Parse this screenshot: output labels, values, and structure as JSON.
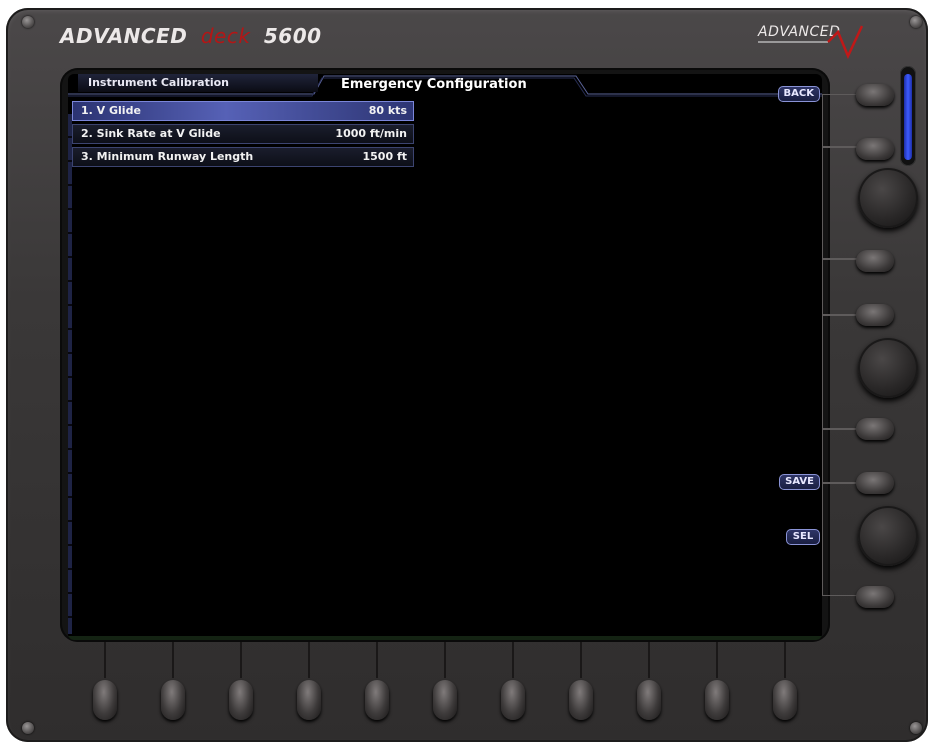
{
  "device": {
    "brand_prefix": "ADVANCED",
    "brand_middle": "deck",
    "brand_model": "5600",
    "logo_text": "ADVANCED"
  },
  "tabs": {
    "inactive": "Instrument Calibration",
    "active": "Emergency Configuration"
  },
  "settings": [
    {
      "label": "1. V Glide",
      "value": "80 kts",
      "selected": true
    },
    {
      "label": "2. Sink Rate at V Glide",
      "value": "1000 ft/min",
      "selected": false
    },
    {
      "label": "3. Minimum Runway Length",
      "value": "1500 ft",
      "selected": false
    }
  ],
  "softkeys": {
    "back": "BACK",
    "save": "SAVE",
    "sel": "SEL"
  },
  "colors": {
    "selected_row": "#5661b6",
    "brand_accent": "#b31616",
    "slider": "#3d5cff"
  }
}
